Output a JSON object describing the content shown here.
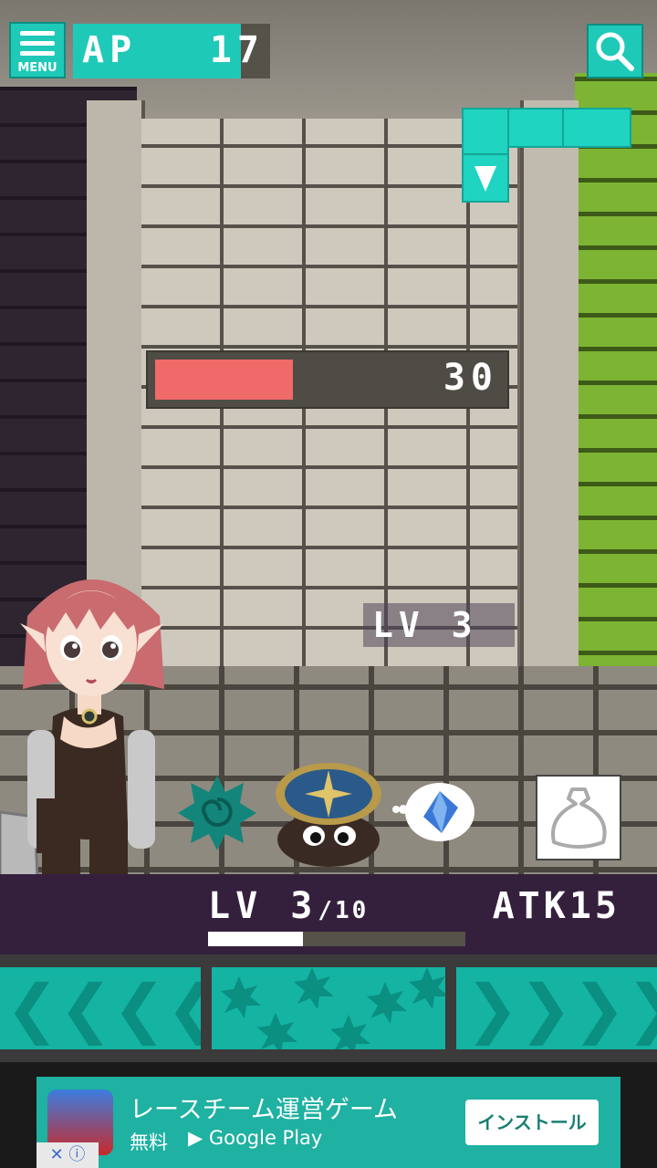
{
  "hud": {
    "menu_label": "MENU",
    "ap_label": "AP",
    "ap_value": "17"
  },
  "enemy": {
    "hp_value": "30",
    "hp_fraction": 0.4,
    "level_label": "LV 3"
  },
  "player": {
    "level_label": "LV 3",
    "level_max": "/10",
    "attack_label": "ATK15",
    "exp_fraction": 0.37
  },
  "ad": {
    "title": "レースチーム運営ゲーム",
    "free_label": "無料",
    "store_label": "Google Play",
    "install_label": "インストール",
    "close_label": "✕ ⓘ"
  },
  "colors": {
    "accent": "#1fc9b8",
    "hp": "#f06a6a",
    "status_band": "#34203d"
  }
}
